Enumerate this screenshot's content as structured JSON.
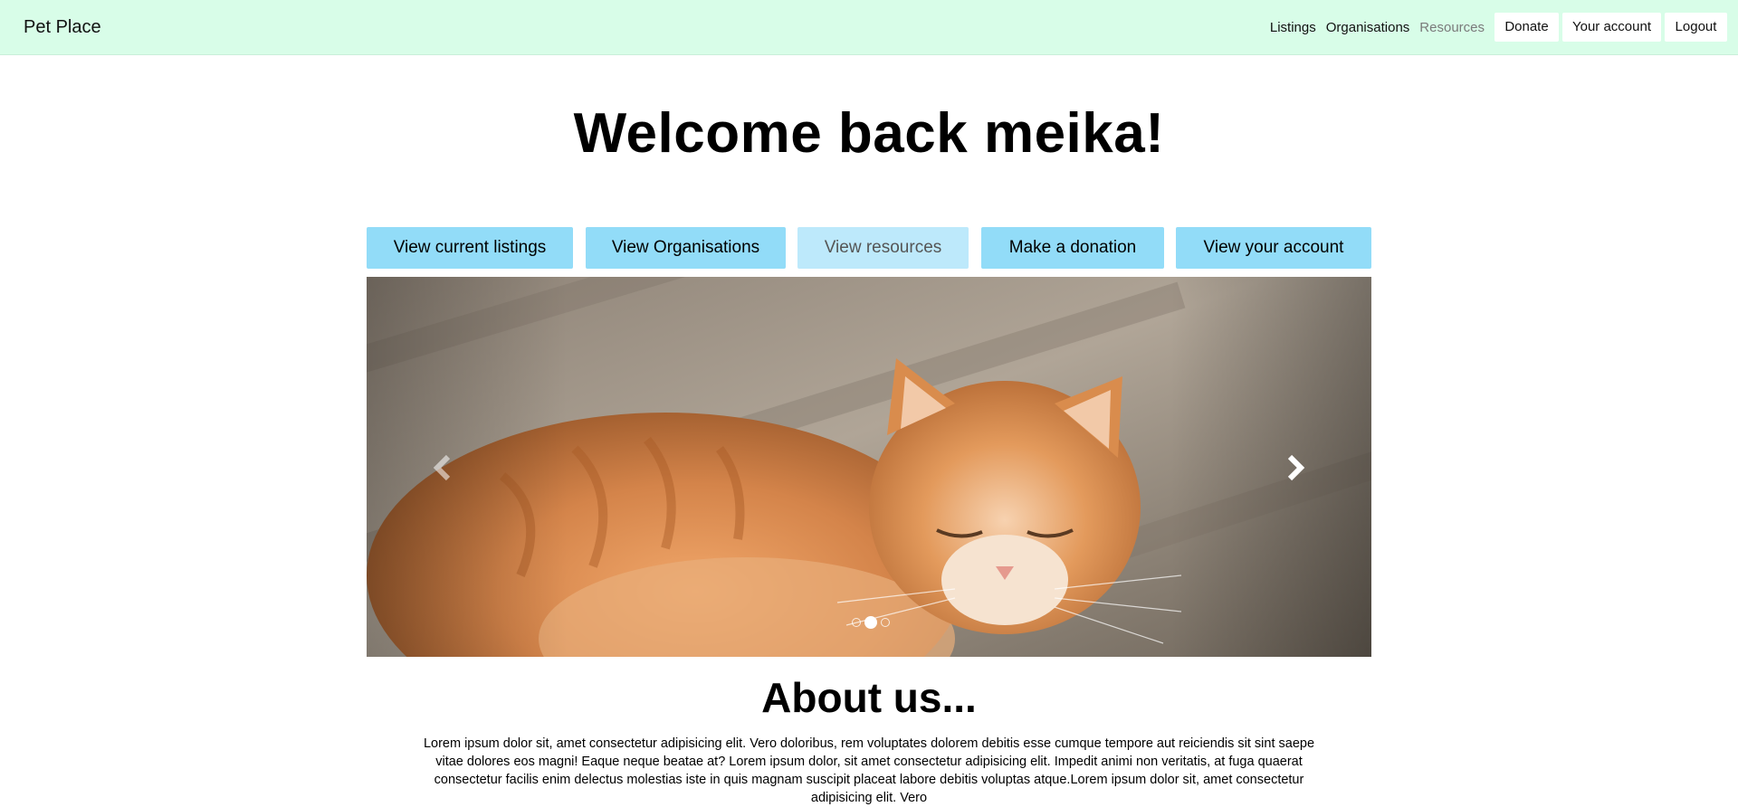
{
  "navbar": {
    "brand": "Pet Place",
    "links": {
      "listings": "Listings",
      "organisations": "Organisations",
      "resources": "Resources"
    },
    "buttons": {
      "donate": "Donate",
      "account": "Your account",
      "logout": "Logout"
    }
  },
  "welcome": "Welcome back meika!",
  "actions": {
    "listings": "View current listings",
    "organisations": "View Organisations",
    "resources": "View resources",
    "donation": "Make a donation",
    "account": "View your account"
  },
  "carousel": {
    "slide_count": 3,
    "active_slide": 2,
    "image": "orange tabby cat sleeping on wooden floor",
    "prev_icon": "chevron-left-icon",
    "next_icon": "chevron-right-icon"
  },
  "about": {
    "title": "About us...",
    "text": "Lorem ipsum dolor sit, amet consectetur adipisicing elit. Vero doloribus, rem voluptates dolorem debitis esse cumque tempore aut reiciendis sit sint saepe vitae dolores eos magni! Eaque neque beatae at? Lorem ipsum dolor, sit amet consectetur adipisicing elit. Impedit animi non veritatis, at fuga quaerat consectetur facilis enim delectus molestias iste in quis magnam suscipit placeat labore debitis voluptas atque.Lorem ipsum dolor sit, amet consectetur adipisicing elit. Vero"
  },
  "colors": {
    "navbar_bg": "#d8fde8",
    "action_button": "#92dcf8",
    "action_button_faded": "#bde9fb"
  }
}
